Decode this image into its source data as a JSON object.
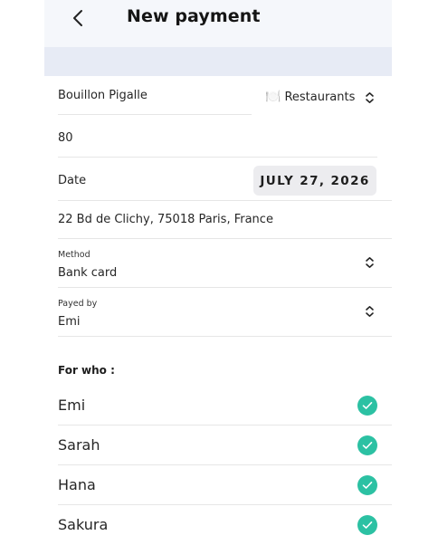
{
  "header": {
    "title": "New payment"
  },
  "payment": {
    "name": "Bouillon Pigalle",
    "category": {
      "icon": "🍽️",
      "label": "Restaurants"
    },
    "amount": "80",
    "date_label": "Date",
    "date_value": "JULY 27, 2026",
    "address": "22 Bd de Clichy, 75018 Paris, France",
    "method": {
      "label": "Method",
      "value": "Bank card"
    },
    "payed_by": {
      "label": "Payed by",
      "value": "Emi"
    }
  },
  "for_who": {
    "title": "For who :",
    "people": [
      {
        "name": "Emi",
        "checked": true
      },
      {
        "name": "Sarah",
        "checked": true
      },
      {
        "name": "Hana",
        "checked": true
      },
      {
        "name": "Sakura",
        "checked": true
      }
    ]
  },
  "colors": {
    "check": "#2cc1a3",
    "band": "#e7ebf5",
    "date_button": "#ececef"
  }
}
